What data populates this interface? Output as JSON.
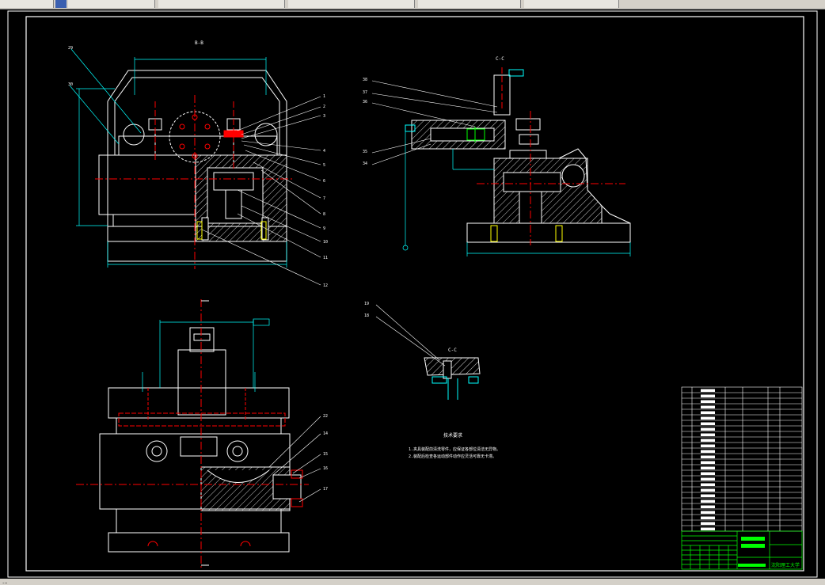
{
  "window": {
    "tabs": [
      "",
      "",
      "",
      "",
      "",
      ""
    ],
    "status_text": "..."
  },
  "colors": {
    "background": "#000000",
    "frame": "#ffffff",
    "outline": "#ffffff",
    "dimension": "#00ffff",
    "section": "#ff0000",
    "hatch": "#ffffff",
    "title_block": "#00ff00",
    "spring": "#00ff00"
  },
  "drawing": {
    "section_titles": {
      "front": "B-B",
      "side": "C-C",
      "detail": "C-C"
    },
    "tech_req": {
      "title": "技术要求",
      "lines": [
        "1.夹具装配前清洗零件，应保证各部位清洁无异物。",
        "2.装配后检查各运动部件动作应灵活可靠无卡滞。"
      ]
    },
    "balloons_front": [
      "29",
      "30",
      "1",
      "2",
      "3",
      "4",
      "5",
      "6",
      "7",
      "8",
      "9",
      "10",
      "11",
      "12"
    ],
    "balloons_side": [
      "38",
      "37",
      "36",
      "35",
      "34"
    ],
    "balloons_plan": [
      "22",
      "14",
      "15",
      "16",
      "17"
    ],
    "balloons_detail": [
      "19",
      "18"
    ],
    "title_block": {
      "company": "沈阳理工大学"
    }
  }
}
